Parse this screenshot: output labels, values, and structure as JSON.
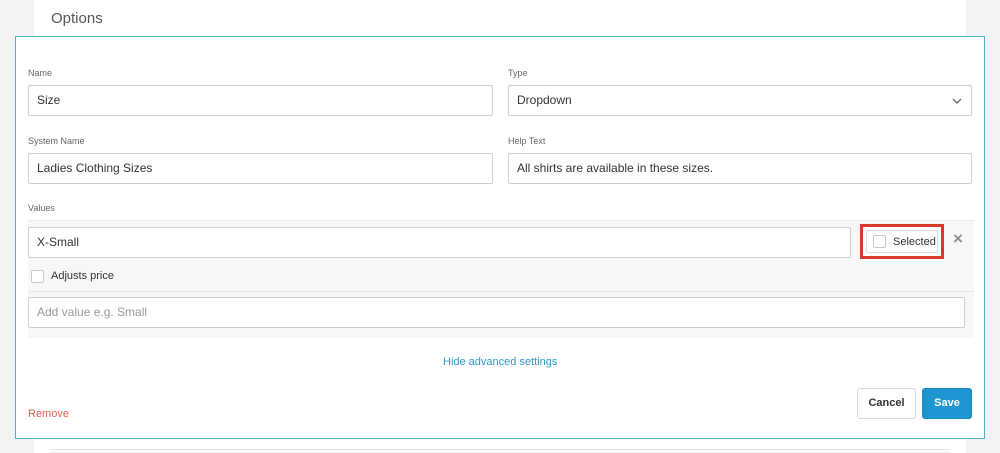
{
  "section": {
    "title": "Options"
  },
  "form": {
    "name": {
      "label": "Name",
      "value": "Size"
    },
    "type": {
      "label": "Type",
      "value": "Dropdown",
      "icon": "chevron-down-icon"
    },
    "system_name": {
      "label": "System Name",
      "value": "Ladies Clothing Sizes"
    },
    "help_text": {
      "label": "Help Text",
      "value": "All shirts are available in these sizes."
    }
  },
  "values": {
    "label": "Values",
    "items": [
      {
        "value": "X-Small",
        "selected_label": "Selected",
        "selected": false,
        "remove_icon": "close-icon"
      }
    ],
    "adjusts_price_label": "Adjusts price",
    "add_placeholder": "Add value e.g. Small"
  },
  "links": {
    "hide_advanced": "Hide advanced settings",
    "remove": "Remove"
  },
  "buttons": {
    "cancel": "Cancel",
    "save": "Save"
  },
  "colors": {
    "accent": "#1e95d0",
    "link": "#2a9bc4",
    "panel_border": "#4fb0c6",
    "danger_text": "#e35d55",
    "highlight": "#d63a2b"
  }
}
